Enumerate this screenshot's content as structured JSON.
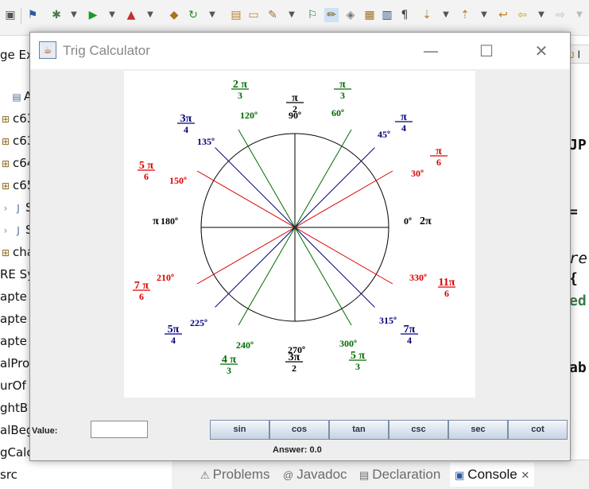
{
  "toolbar": {
    "icons": [
      "save-icon",
      "debug-icon",
      "run-icon",
      "external-tools-icon",
      "new-class-icon",
      "open-type-icon",
      "search-icon",
      "task-icon",
      "annotation-icon",
      "next-icon",
      "previous-icon",
      "back-icon",
      "forward-icon"
    ]
  },
  "left_tree": {
    "items": [
      "ge Ex",
      "A",
      "c63",
      "c63",
      "c64",
      "c65",
      "S",
      "S",
      "cha",
      "RE Sy",
      "apte",
      "apte",
      "apte",
      "alPro",
      "urOf",
      "ghtB",
      "alBeg",
      "gCalc",
      "src"
    ]
  },
  "right_code": [
    "JP",
    "=",
    "re",
    "{",
    "ed",
    "ab"
  ],
  "right_tab": "I",
  "bottom_tabs": [
    {
      "icon": "problems-icon",
      "label": "Problems"
    },
    {
      "icon": "javadoc-icon",
      "label": "Javadoc"
    },
    {
      "icon": "declaration-icon",
      "label": "Declaration"
    },
    {
      "icon": "console-icon",
      "label": "Console"
    }
  ],
  "window": {
    "title": "Trig Calculator",
    "minimize": "—",
    "maximize": "☐",
    "close": "✕"
  },
  "unit_circle": {
    "colors": {
      "black": "#000000",
      "red": "#dd0000",
      "blue": "#00007a",
      "green": "#006b00"
    },
    "angles": [
      {
        "deg": "0º",
        "rad_text": "2π",
        "color": "black"
      },
      {
        "deg": "30º",
        "rad_num": "π",
        "rad_den": "6",
        "color": "red"
      },
      {
        "deg": "45º",
        "rad_num": "π",
        "rad_den": "4",
        "color": "blue"
      },
      {
        "deg": "60º",
        "rad_num": "π",
        "rad_den": "3",
        "color": "green"
      },
      {
        "deg": "90º",
        "rad_num": "π",
        "rad_den": "2",
        "color": "black"
      },
      {
        "deg": "120º",
        "rad_num": "2 π",
        "rad_den": "3",
        "color": "green"
      },
      {
        "deg": "135º",
        "rad_num": "3π",
        "rad_den": "4",
        "color": "blue"
      },
      {
        "deg": "150º",
        "rad_num": "5 π",
        "rad_den": "6",
        "color": "red"
      },
      {
        "deg": "180º",
        "rad_text": "π",
        "color": "black"
      },
      {
        "deg": "210º",
        "rad_num": "7 π",
        "rad_den": "6",
        "color": "red"
      },
      {
        "deg": "225º",
        "rad_num": "5π",
        "rad_den": "4",
        "color": "blue"
      },
      {
        "deg": "240º",
        "rad_num": "4 π",
        "rad_den": "3",
        "color": "green"
      },
      {
        "deg": "270º",
        "rad_num": "3π",
        "rad_den": "2",
        "color": "black"
      },
      {
        "deg": "300º",
        "rad_num": "5 π",
        "rad_den": "3",
        "color": "green"
      },
      {
        "deg": "315º",
        "rad_num": "7π",
        "rad_den": "4",
        "color": "blue"
      },
      {
        "deg": "330º",
        "rad_num": "11π",
        "rad_den": "6",
        "color": "red"
      }
    ]
  },
  "form": {
    "value_label": "Value:",
    "value_input": ""
  },
  "buttons": [
    "sin",
    "cos",
    "tan",
    "csc",
    "sec",
    "cot"
  ],
  "answer": "Answer: 0.0"
}
